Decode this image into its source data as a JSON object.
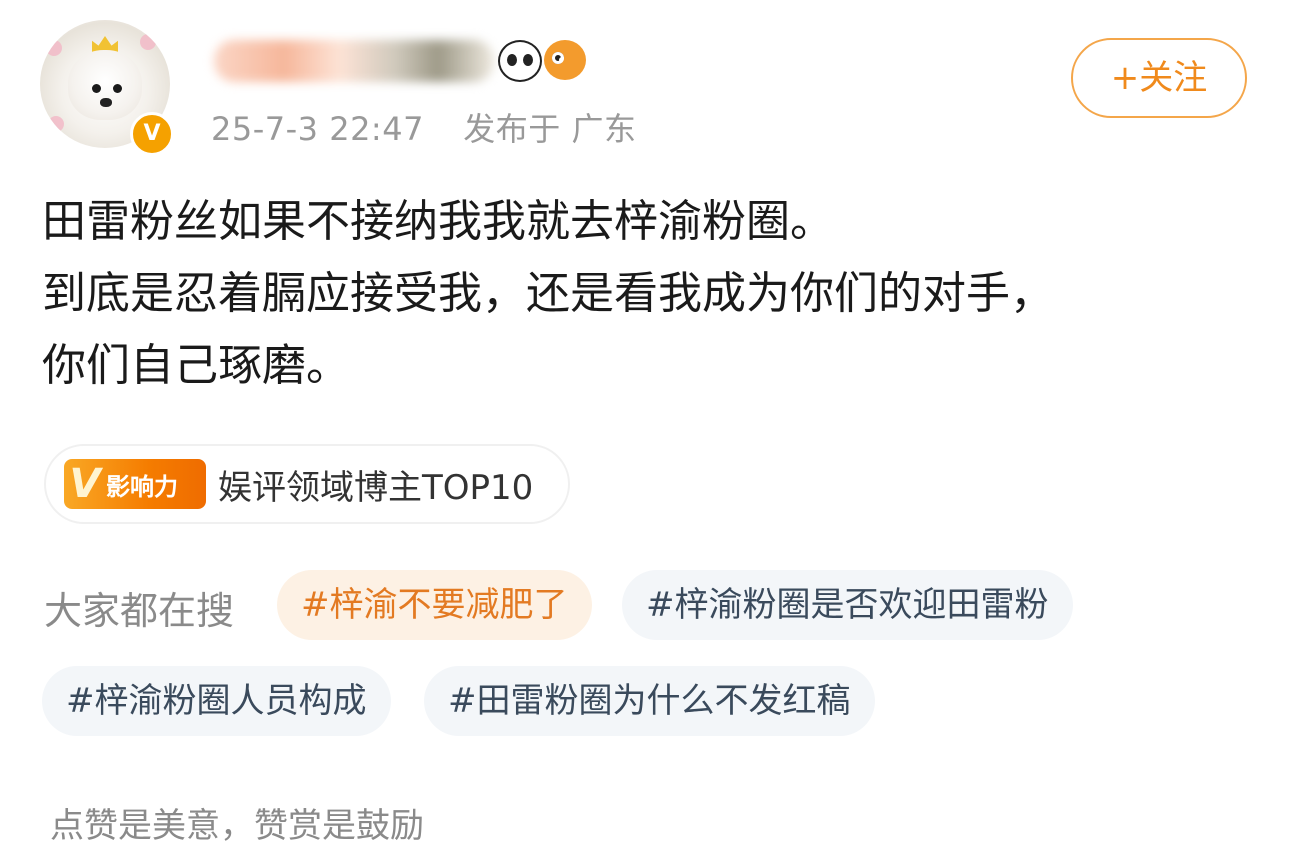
{
  "post": {
    "username": "",
    "timestamp": "25-7-3 22:47",
    "location": "发布于 广东",
    "follow_label": "+关注",
    "lines": [
      "田雷粉丝如果不接纳我我就去梓渝粉圈。",
      "到底是忍着膈应接受我，还是看我成为你们的对手，",
      "你们自己琢磨。"
    ]
  },
  "badge": {
    "logo_letter": "V",
    "logo_text": "影响力",
    "text": "娱评领域博主TOP10"
  },
  "search": {
    "label": "大家都在搜",
    "tags": [
      "#梓渝不要减肥了",
      "#梓渝粉圈是否欢迎田雷粉",
      "#梓渝粉圈人员构成",
      "#田雷粉圈为什么不发红稿"
    ]
  },
  "footer": {
    "text": "点赞是美意，赞赏是鼓励"
  },
  "icons": {
    "verified": "verified-badge-icon",
    "emoji_1": "panda-icon",
    "emoji_2": "fish-icon"
  },
  "colors": {
    "accent": "#f08a1c",
    "verified": "#f5a100",
    "hot_tag_bg": "#fdf1e4",
    "tag_bg": "#f3f6f9"
  }
}
